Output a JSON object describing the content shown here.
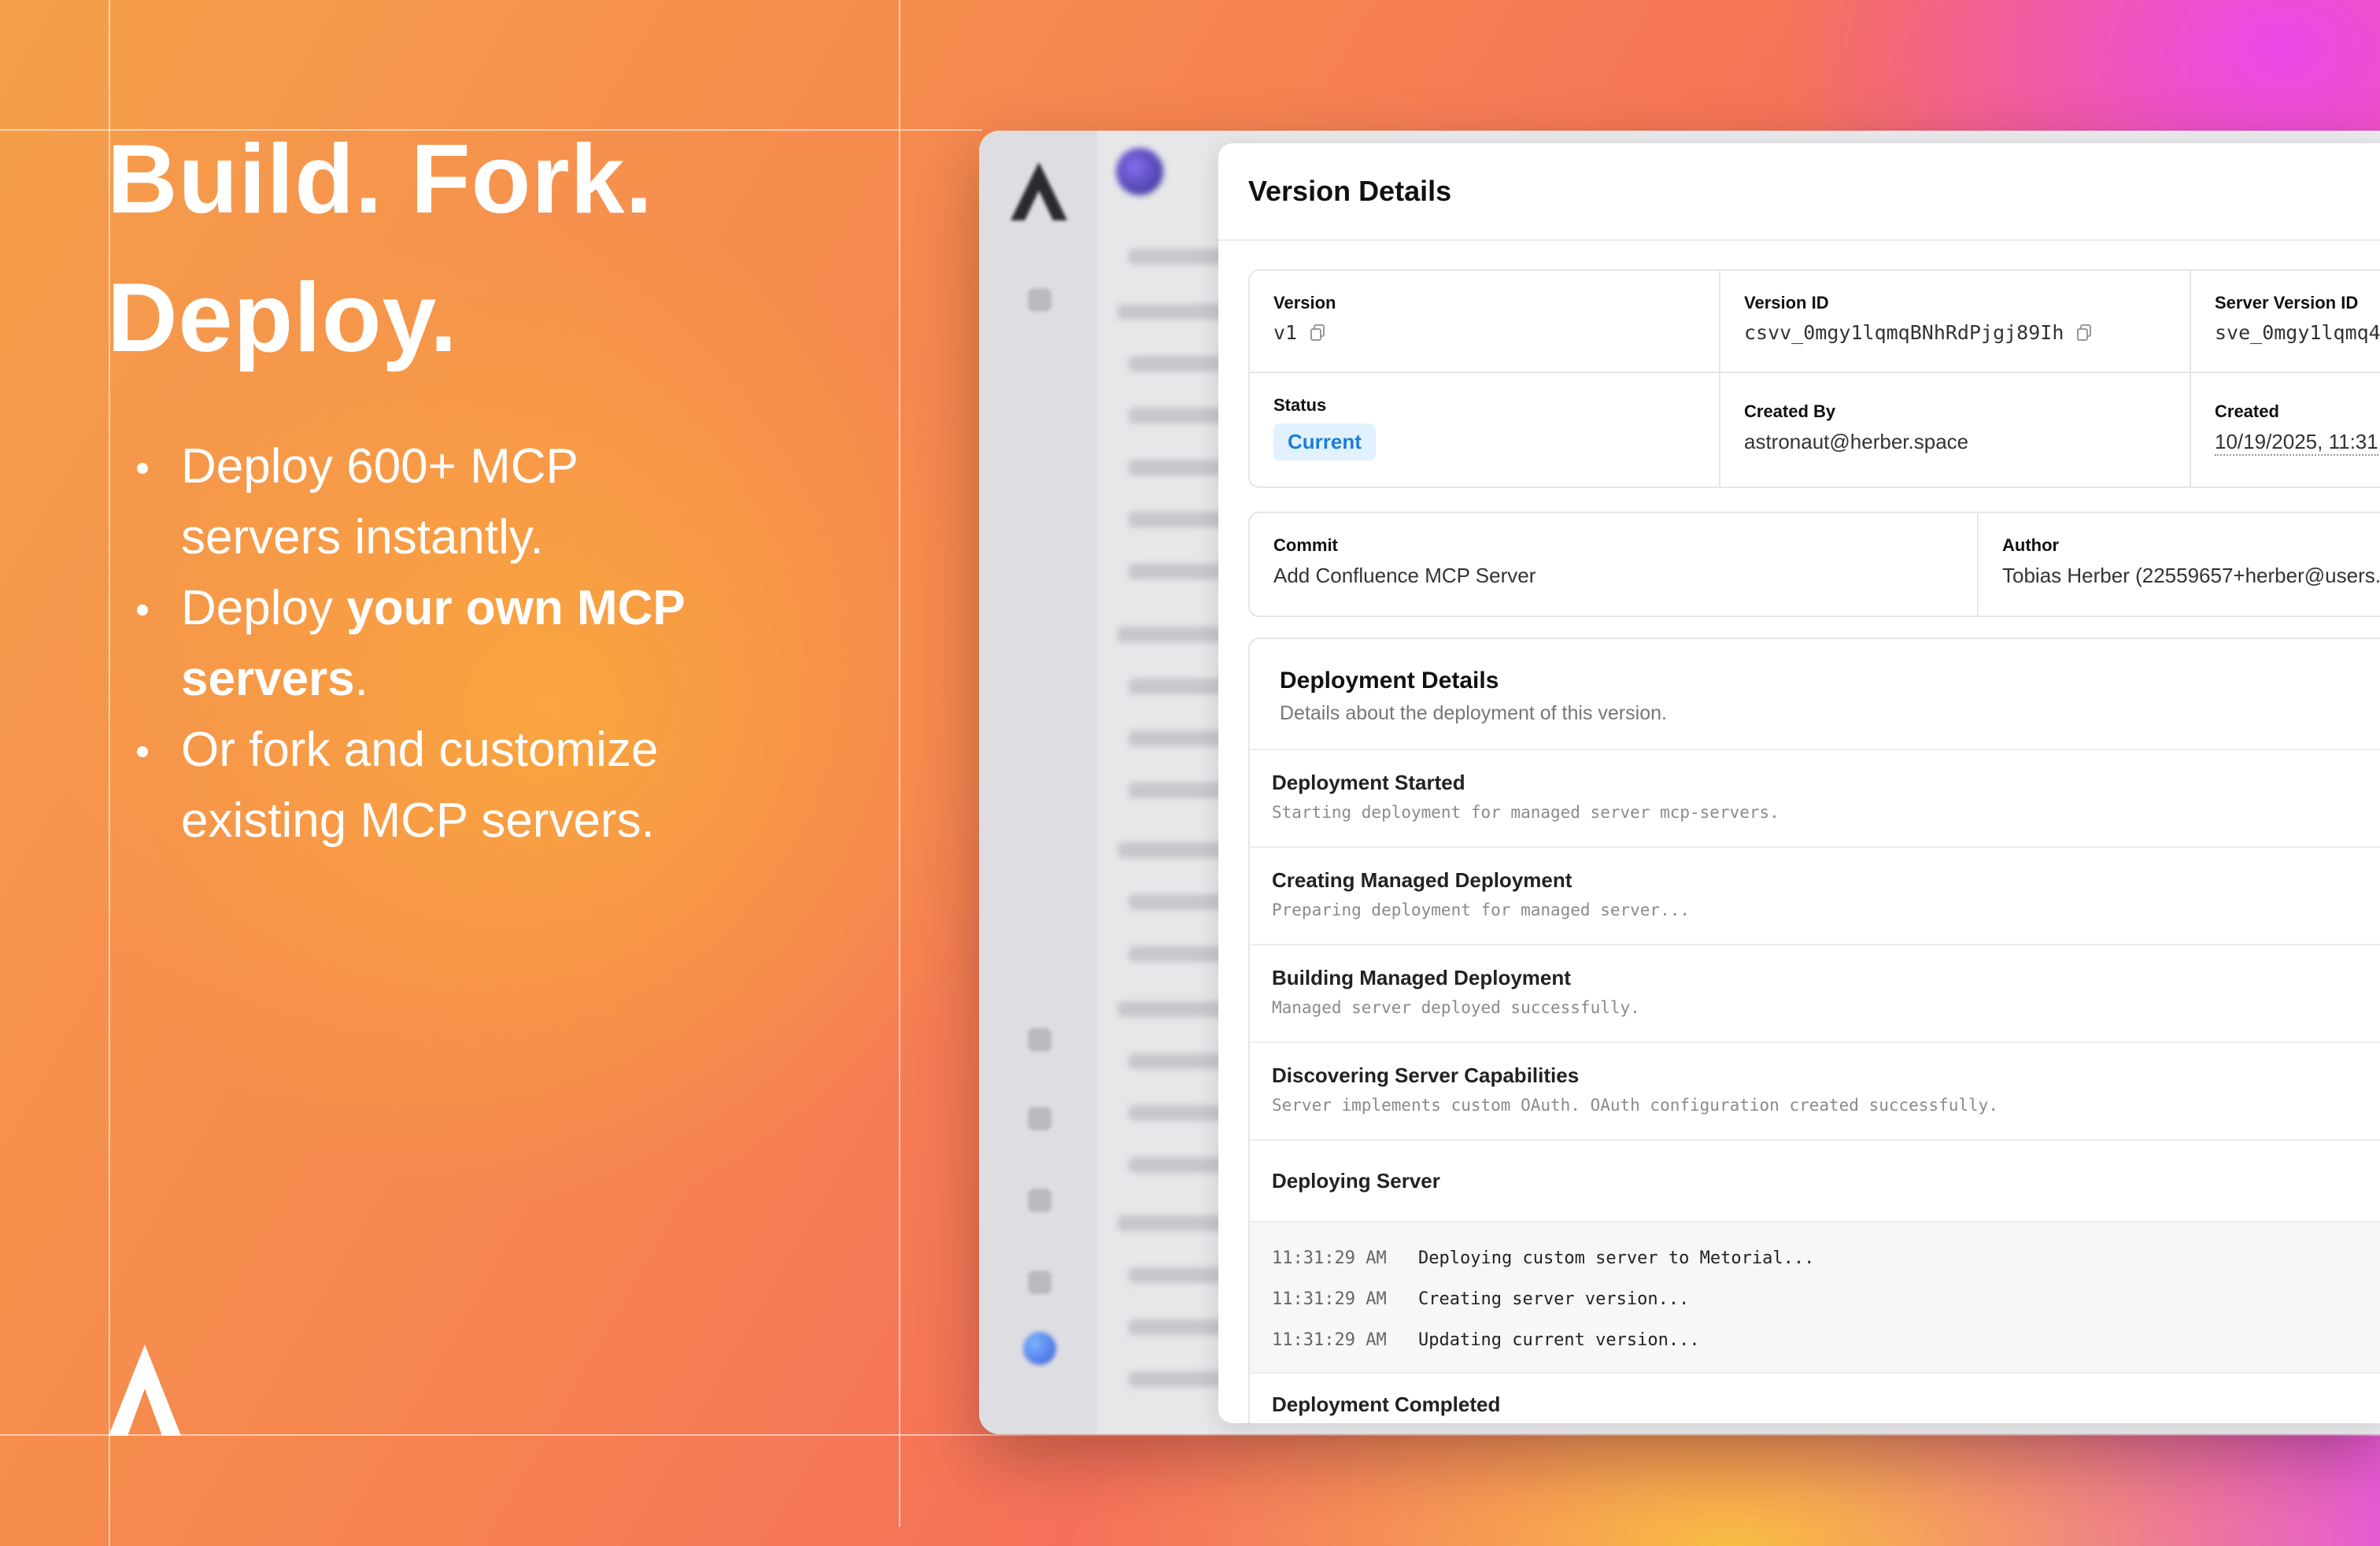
{
  "hero": {
    "headline_line1": "Build. Fork.",
    "headline_line2": "Deploy."
  },
  "bullets": [
    {
      "pre": "Deploy 600+ MCP servers instantly.",
      "bold": "",
      "post": ""
    },
    {
      "pre": "Deploy ",
      "bold": "your own MCP servers",
      "post": "."
    },
    {
      "pre": "Or fork and customize existing MCP servers.",
      "bold": "",
      "post": ""
    }
  ],
  "panel": {
    "title": "Version Details",
    "info": {
      "version_label": "Version",
      "version_value": "v1",
      "version_id_label": "Version ID",
      "version_id_value": "csvv_0mgy1lqmqBNhRdPjgj89Ih",
      "server_version_id_label": "Server Version ID",
      "server_version_id_value": "sve_0mgy1lqmq4",
      "status_label": "Status",
      "status_value": "Current",
      "created_by_label": "Created By",
      "created_by_value": "astronaut@herber.space",
      "created_label": "Created",
      "created_value": "10/19/2025, 11:31"
    },
    "commit": {
      "commit_label": "Commit",
      "commit_value": "Add Confluence MCP Server",
      "author_label": "Author",
      "author_value": "Tobias Herber (22559657+herber@users."
    },
    "deployment": {
      "title": "Deployment Details",
      "subtitle": "Details about the deployment of this version.",
      "steps": [
        {
          "title": "Deployment Started",
          "desc": "Starting deployment for managed server mcp-servers."
        },
        {
          "title": "Creating Managed Deployment",
          "desc": "Preparing deployment for managed server..."
        },
        {
          "title": "Building Managed Deployment",
          "desc": "Managed server deployed successfully."
        },
        {
          "title": "Discovering Server Capabilities",
          "desc": "Server implements custom OAuth. OAuth configuration created successfully."
        }
      ],
      "deploying_title": "Deploying Server",
      "logs": [
        {
          "time": "11:31:29 AM",
          "msg": "Deploying custom server to Metorial..."
        },
        {
          "time": "11:31:29 AM",
          "msg": "Creating server version..."
        },
        {
          "time": "11:31:29 AM",
          "msg": "Updating current version..."
        }
      ],
      "completed_title": "Deployment Completed"
    }
  },
  "icons": {
    "brand": "metorial-logo-icon",
    "copy": "copy-icon"
  },
  "colors": {
    "status_bg": "#e1f1fd",
    "status_text": "#1c7ed6"
  }
}
